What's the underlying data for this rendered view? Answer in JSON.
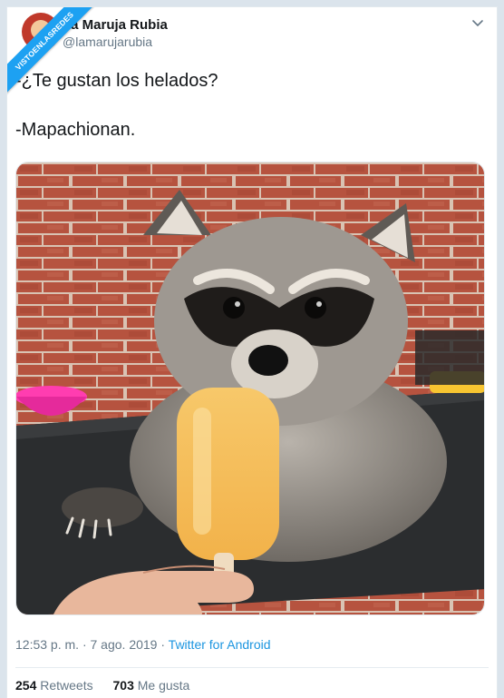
{
  "watermark": "VISTOENLASREDES",
  "tweet": {
    "display_name": "La Maruja Rubia",
    "handle": "@lamarujarubia",
    "line1": "-¿Te gustan los helados?",
    "line2": "-Mapachionan.",
    "time": "12:53 p. m.",
    "separator1": "·",
    "date": "7 ago. 2019",
    "separator2": "·",
    "source": "Twitter for Android",
    "retweets_count": "254",
    "retweets_label": "Retweets",
    "likes_count": "703",
    "likes_label": "Me gusta"
  },
  "icons": {
    "menu": "chevron-down-icon",
    "avatar": "avatar"
  },
  "colors": {
    "accent": "#1da1f2",
    "link": "#1b95e0",
    "muted": "#657786",
    "text": "#14171a"
  }
}
